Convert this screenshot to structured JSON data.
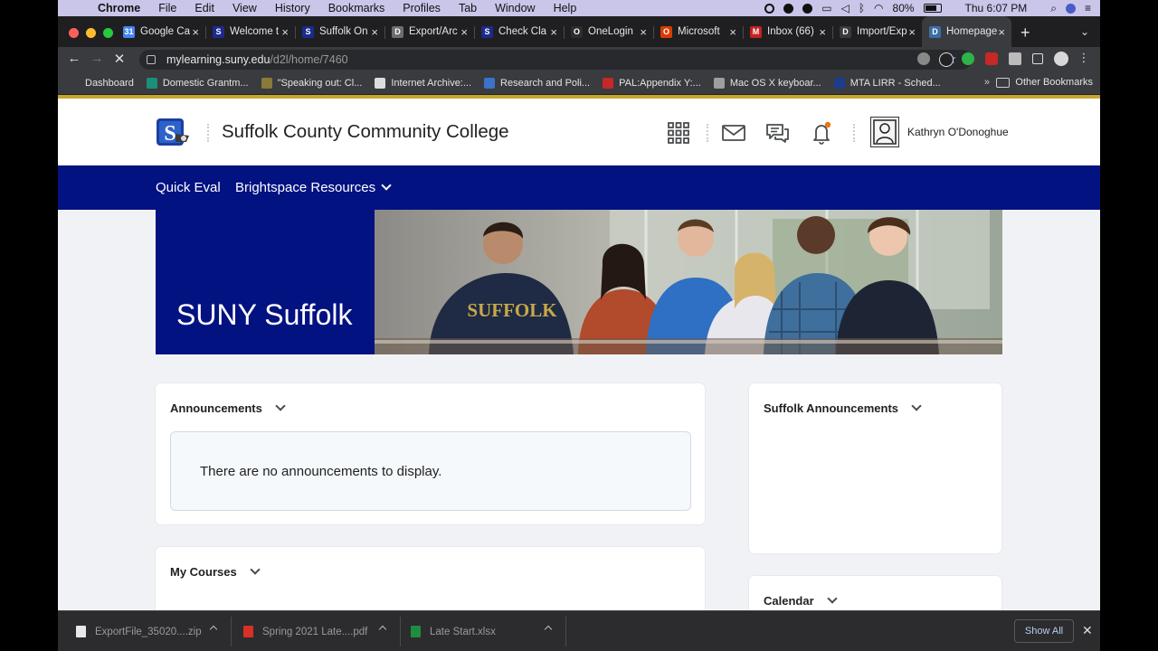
{
  "menubar": {
    "app_name": "Chrome",
    "items": [
      "File",
      "Edit",
      "View",
      "History",
      "Bookmarks",
      "Profiles",
      "Tab",
      "Window",
      "Help"
    ],
    "battery": "80%",
    "clock": "Thu 6:07 PM"
  },
  "tabs": [
    {
      "title": "Google Ca",
      "color": "#4285f4",
      "letter": "31"
    },
    {
      "title": "Welcome t",
      "color": "#1c2a8c",
      "letter": "S"
    },
    {
      "title": "Suffolk On",
      "color": "#1c2a8c",
      "letter": "S"
    },
    {
      "title": "Export/Arc",
      "color": "#6d6d6d",
      "letter": "D"
    },
    {
      "title": "Check Cla",
      "color": "#1c2a8c",
      "letter": "S"
    },
    {
      "title": "OneLogin",
      "color": "#2d2d2d",
      "letter": "O"
    },
    {
      "title": "Microsoft",
      "color": "#d83b01",
      "letter": "O"
    },
    {
      "title": "Inbox (66)",
      "color": "#c5221f",
      "letter": "M"
    },
    {
      "title": "Import/Exp",
      "color": "#3a3a3a",
      "letter": "D"
    },
    {
      "title": "Homepage",
      "color": "#3a6ea5",
      "letter": "D",
      "active": true
    }
  ],
  "toolbar": {
    "url_host": "mylearning.suny.edu",
    "url_path": "/d2l/home/7460"
  },
  "bookmarks": [
    {
      "label": "Dashboard",
      "color": "#1c2a8c"
    },
    {
      "label": "Domestic Grantm...",
      "color": "#1a8f7a"
    },
    {
      "label": "\"Speaking out: Cl...",
      "color": "#8a7a3a"
    },
    {
      "label": "Internet Archive:...",
      "color": "#dddddd"
    },
    {
      "label": "Research and Poli...",
      "color": "#3b73c8"
    },
    {
      "label": "PAL:Appendix Y:...",
      "color": "#c62828"
    },
    {
      "label": "Mac OS X keyboar...",
      "color": "#9e9e9e"
    },
    {
      "label": "MTA LIRR - Sched...",
      "color": "#1e3c8c"
    }
  ],
  "bookmarks_more": "»",
  "other_bookmarks": "Other Bookmarks",
  "header": {
    "org_name": "Suffolk County Community College",
    "user_name": "Kathryn O'Donoghue"
  },
  "nav": {
    "quick_eval": "Quick Eval",
    "resources": "Brightspace Resources"
  },
  "banner": {
    "title": "SUNY Suffolk",
    "sweater_text": "SUFFOLK"
  },
  "widgets": {
    "announcements": {
      "title": "Announcements",
      "empty_message": "There are no announcements to display."
    },
    "suffolk_announcements": {
      "title": "Suffolk Announcements"
    },
    "my_courses": {
      "title": "My Courses"
    },
    "calendar": {
      "title": "Calendar"
    }
  },
  "downloads": [
    {
      "name": "ExportFile_35020....zip",
      "color": "#e8e8e8"
    },
    {
      "name": "Spring 2021 Late....pdf",
      "color": "#d93025"
    },
    {
      "name": "Late Start.xlsx",
      "color": "#1e8e3e"
    }
  ],
  "downloads_show_all": "Show All",
  "colors": {
    "brand_navy": "#031281",
    "accent_gold": "#c7a52e",
    "notification_dot": "#e87511"
  }
}
